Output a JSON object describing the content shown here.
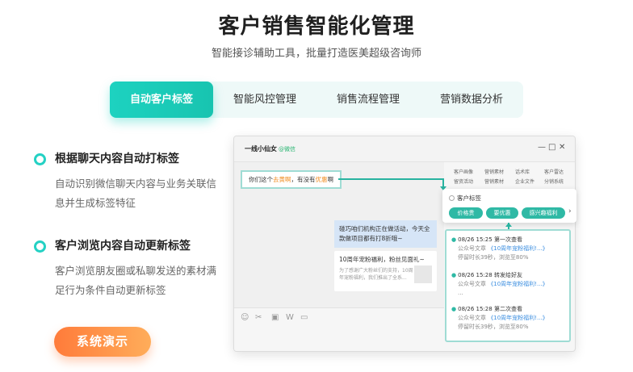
{
  "header": {
    "title": "客户销售智能化管理",
    "subtitle": "智能接诊辅助工具，批量打造医美超级咨询师"
  },
  "tabs": [
    {
      "label": "自动客户标签",
      "active": true
    },
    {
      "label": "智能风控管理",
      "active": false
    },
    {
      "label": "销售流程管理",
      "active": false
    },
    {
      "label": "营销数据分析",
      "active": false
    }
  ],
  "features": [
    {
      "title": "根据聊天内容自动打标签",
      "desc": "自动识别微信聊天内容与业务关联信息并生成标签特征"
    },
    {
      "title": "客户浏览内容自动更新标签",
      "desc": "客户浏览朋友圈或私聊发送的素材满足行为条件自动更新标签"
    }
  ],
  "demo_button": "系统演示",
  "mockup": {
    "window_title": "一线小仙女",
    "window_title_tag": "@微信",
    "controls": [
      "—",
      "□",
      "✕"
    ],
    "msg_left_prefix": "你们这个",
    "msg_left_hl1": "去黄啊",
    "msg_left_mid": "，有没有",
    "msg_left_hl2": "优惠",
    "msg_left_suffix": "啊",
    "msg_right": "碰巧咱们机构正在做活动，今天全款做项目都有打8折哦~",
    "card_title": "10周年宠粉福利，粉丝见面礼~",
    "card_desc": "为了感谢广大粉丝们的支持，10周年宠粉福利，我们推出了全系...",
    "side_menu": [
      "客户画像",
      "营销素材",
      "话术库",
      "客户雷达",
      "留资活动",
      "营销素材",
      "企业文件",
      "分销系统"
    ],
    "tag_panel_label": "客户标签",
    "tags": [
      "价格贵",
      "要优惠",
      "感兴趣福利"
    ],
    "tag_more": "›",
    "timeline": [
      {
        "date": "08/26",
        "time": "15:25",
        "event": "第一次查看",
        "prefix": "公众号文章",
        "link": "《10周年宠粉福利!...》",
        "sub": "停留时长39秒，浏览至80%"
      },
      {
        "date": "08/26",
        "time": "15:28",
        "event": "转发给好友",
        "prefix": "公众号文章",
        "link": "《10周年宠粉福利!...》",
        "sub": "..."
      },
      {
        "date": "08/26",
        "time": "15:28",
        "event": "第二次查看",
        "prefix": "公众号文章",
        "link": "《10周年宠粉福利!...》",
        "sub": "停留时长39秒，浏览至80%"
      }
    ],
    "toolbar_icons": [
      "emoji-icon",
      "scissors-icon",
      "image-icon",
      "word-icon",
      "folder-icon"
    ]
  },
  "colors": {
    "accent": "#1dd2c0",
    "orange": "#ff7b3a",
    "tag_green": "#2fb9a5",
    "link_blue": "#3d8fe0",
    "highlight_orange": "#f08a1c"
  }
}
